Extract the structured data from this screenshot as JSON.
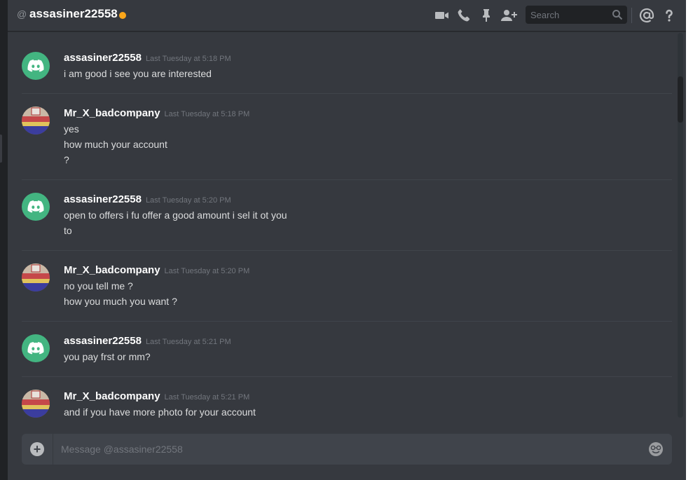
{
  "header": {
    "title": "assasiner22558",
    "status_color": "#faa61a",
    "icons": [
      "video-call-icon",
      "voice-call-icon",
      "pin-icon",
      "add-friend-icon",
      "mentions-icon",
      "help-icon"
    ],
    "search_placeholder": "Search"
  },
  "messages": [
    {
      "author": "assasiner22558",
      "timestamp": "Last Tuesday at 5:18 PM",
      "avatar": "discord-logo",
      "lines": [
        "i am good i see you are interested"
      ]
    },
    {
      "author": "Mr_X_badcompany",
      "timestamp": "Last Tuesday at 5:18 PM",
      "avatar": "photo",
      "lines": [
        "yes",
        "how much your account",
        "?"
      ]
    },
    {
      "author": "assasiner22558",
      "timestamp": "Last Tuesday at 5:20 PM",
      "avatar": "discord-logo",
      "lines": [
        "open to offers i fu offer a good amount i sel it ot you",
        "to"
      ]
    },
    {
      "author": "Mr_X_badcompany",
      "timestamp": "Last Tuesday at 5:20 PM",
      "avatar": "photo",
      "lines": [
        "no you tell me ?",
        "how you much you want ?"
      ]
    },
    {
      "author": "assasiner22558",
      "timestamp": "Last Tuesday at 5:21 PM",
      "avatar": "discord-logo",
      "lines": [
        "you pay frst or mm?"
      ]
    },
    {
      "author": "Mr_X_badcompany",
      "timestamp": "Last Tuesday at 5:21 PM",
      "avatar": "photo",
      "lines": [
        "and if you have more photo for your account"
      ]
    }
  ],
  "composer": {
    "placeholder": "Message @assasiner22558"
  },
  "colors": {
    "accent_green": "#43b581",
    "background": "#36393f"
  }
}
